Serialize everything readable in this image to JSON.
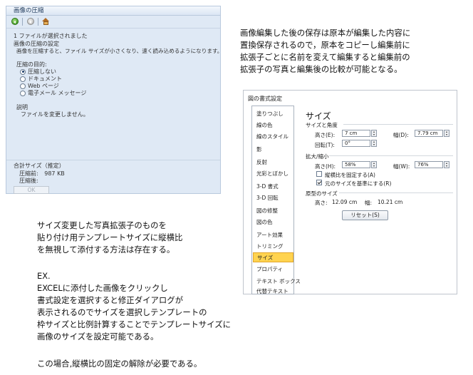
{
  "compress": {
    "title": "画像の圧縮",
    "selection_status": "1 ファイルが選択されました",
    "settings_heading": "画像の圧縮の設定",
    "settings_desc": "画像を圧縮すると、ファイル サイズが小さくなり、速く読み込めるようになります。",
    "purpose_label": "圧縮の目的:",
    "options": [
      {
        "label": "圧縮しない",
        "checked": true
      },
      {
        "label": "ドキュメント",
        "checked": false
      },
      {
        "label": "Web ページ",
        "checked": false
      },
      {
        "label": "電子メール メッセージ",
        "checked": false
      }
    ],
    "explain_label": "説明",
    "explain_text": "ファイルを変更しません。",
    "total_label": "合計サイズ（推定）",
    "before_label": "圧縮前:",
    "before_value": "987 KB",
    "after_label": "圧縮後:",
    "ok_label": "OK",
    "icons": [
      "back-arrow-icon",
      "forward-arrow-icon",
      "home-icon"
    ]
  },
  "note_right": [
    "画像編集した後の保存は原本が編集した内容に",
    "置換保存されるので，原本をコピーし編集前に",
    "拡張子ごとに名前を変えて編集すると編集前の",
    "拡張子の写真と編集後の比較が可能となる。"
  ],
  "format_dialog": {
    "title": "図の書式設定",
    "nav": [
      {
        "label": "塗りつぶし",
        "selected": false
      },
      {
        "label": "線の色",
        "selected": false
      },
      {
        "label": "線のスタイル",
        "selected": false
      },
      {
        "label": "影",
        "selected": false
      },
      {
        "label": "反射",
        "selected": false
      },
      {
        "label": "光彩とぼかし",
        "selected": false
      },
      {
        "label": "3-D 書式",
        "selected": false
      },
      {
        "label": "3-D 回転",
        "selected": false
      },
      {
        "label": "図の修整",
        "selected": false
      },
      {
        "label": "図の色",
        "selected": false
      },
      {
        "label": "アート効果",
        "selected": false
      },
      {
        "label": "トリミング",
        "selected": false
      },
      {
        "label": "サイズ",
        "selected": true
      },
      {
        "label": "プロパティ",
        "selected": false
      },
      {
        "label": "テキスト ボックス",
        "selected": false
      },
      {
        "label": "代替テキスト",
        "selected": false
      }
    ],
    "heading": "サイズ",
    "section_size": "サイズと角度",
    "height_label": "高さ(E):",
    "height_value": "7 cm",
    "width_label": "幅(D):",
    "width_value": "7.79 cm",
    "rotate_label": "回転(T):",
    "rotate_value": "0°",
    "section_scale": "拡大/縮小",
    "scale_h_label": "高さ(H):",
    "scale_h_value": "58%",
    "scale_w_label": "幅(W):",
    "scale_w_value": "76%",
    "lock_aspect_label": "縦横比を固定する(A)",
    "lock_aspect_checked": false,
    "relative_label": "元のサイズを基準にする(R)",
    "relative_checked": true,
    "section_original": "原型のサイズ",
    "orig_h_label": "高さ:",
    "orig_h_value": "12.09 cm",
    "orig_w_label": "幅:",
    "orig_w_value": "10.21 cm",
    "reset_label": "リセット(S)"
  },
  "note_bottom": [
    "サイズ変更した写真拡張子のものを",
    "貼り付け用テンプレートサイズに縦横比",
    "を無視して添付する方法は存在する。",
    "EX.",
    "EXCELに添付した画像をクリックし",
    "書式設定を選択すると修正ダイアログが",
    "表示されるのでサイズを選択しテンプレートの",
    "枠サイズと比例計算することでテンプレートサイズに",
    "画像のサイズを設定可能である。",
    "この場合,縦横比の固定の解除が必要である。"
  ]
}
